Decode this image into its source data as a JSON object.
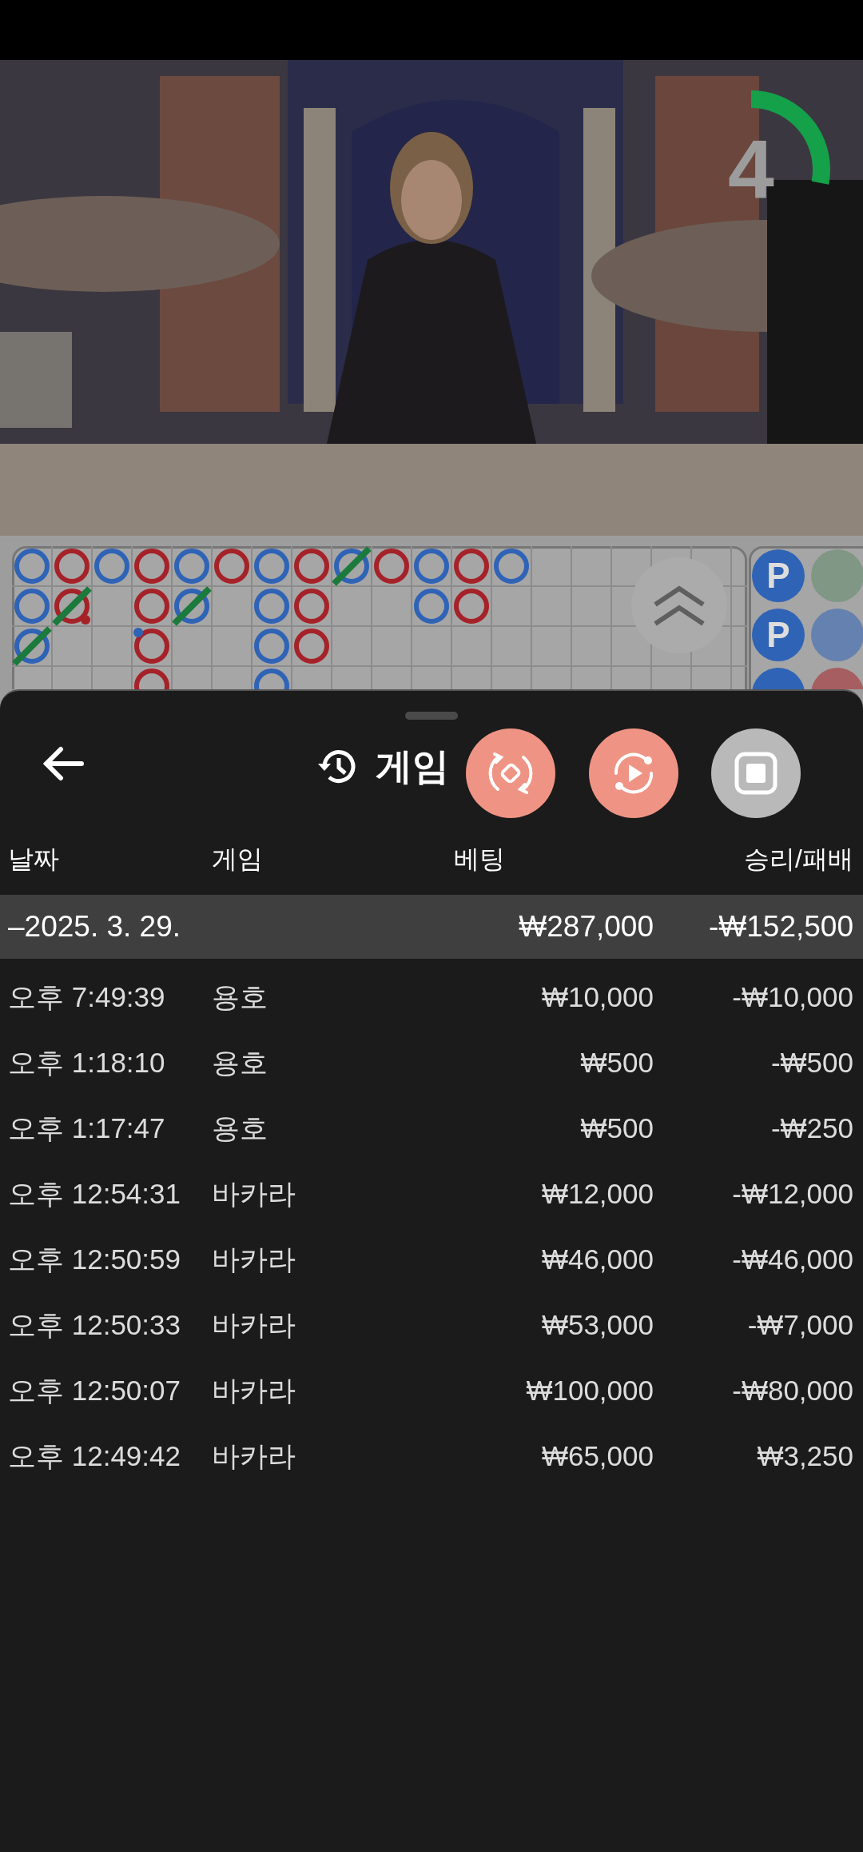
{
  "video": {
    "kind": "picture",
    "timer": {
      "value": "4",
      "level": 0.28
    }
  },
  "road": {
    "big_road": [
      [
        {
          "kind": "player",
          "tie": false,
          "banker_pair": false,
          "player_pair": false
        },
        {
          "kind": "player",
          "tie": false,
          "banker_pair": false,
          "player_pair": false
        },
        {
          "kind": "player",
          "tie": true,
          "banker_pair": false,
          "player_pair": false
        }
      ],
      [
        {
          "kind": "banker",
          "tie": false,
          "banker_pair": false,
          "player_pair": false
        },
        {
          "kind": "banker",
          "tie": true,
          "banker_pair": true,
          "player_pair": false
        }
      ],
      [
        {
          "kind": "player",
          "tie": false,
          "banker_pair": false,
          "player_pair": false
        }
      ],
      [
        {
          "kind": "banker",
          "tie": false,
          "banker_pair": false,
          "player_pair": false
        },
        {
          "kind": "banker",
          "tie": false,
          "banker_pair": false,
          "player_pair": false
        },
        {
          "kind": "banker",
          "tie": false,
          "banker_pair": false,
          "player_pair": true
        },
        {
          "kind": "banker",
          "tie": false,
          "banker_pair": false,
          "player_pair": false
        }
      ],
      [
        {
          "kind": "player",
          "tie": false,
          "banker_pair": false,
          "player_pair": false
        },
        {
          "kind": "player",
          "tie": true,
          "banker_pair": false,
          "player_pair": false
        }
      ],
      [
        {
          "kind": "banker",
          "tie": false,
          "banker_pair": false,
          "player_pair": false
        }
      ],
      [
        {
          "kind": "player",
          "tie": false,
          "banker_pair": false,
          "player_pair": false
        },
        {
          "kind": "player",
          "tie": false,
          "banker_pair": false,
          "player_pair": false
        },
        {
          "kind": "player",
          "tie": false,
          "banker_pair": false,
          "player_pair": false
        },
        {
          "kind": "player",
          "tie": false,
          "banker_pair": false,
          "player_pair": false
        }
      ],
      [
        {
          "kind": "banker",
          "tie": false,
          "banker_pair": false,
          "player_pair": false
        },
        {
          "kind": "banker",
          "tie": false,
          "banker_pair": false,
          "player_pair": false
        },
        {
          "kind": "banker",
          "tie": false,
          "banker_pair": false,
          "player_pair": false
        }
      ],
      [
        {
          "kind": "player",
          "tie": true,
          "banker_pair": false,
          "player_pair": false
        }
      ],
      [
        {
          "kind": "banker",
          "tie": false,
          "banker_pair": false,
          "player_pair": false
        }
      ],
      [
        {
          "kind": "player",
          "tie": false,
          "banker_pair": false,
          "player_pair": false
        },
        {
          "kind": "player",
          "tie": false,
          "banker_pair": false,
          "player_pair": false
        }
      ],
      [
        {
          "kind": "banker",
          "tie": false,
          "banker_pair": false,
          "player_pair": false
        },
        {
          "kind": "banker",
          "tie": false,
          "banker_pair": false,
          "player_pair": false
        }
      ],
      [
        {
          "kind": "player",
          "tie": false,
          "banker_pair": false,
          "player_pair": false
        }
      ]
    ],
    "bead_plate": [
      [
        {
          "kind": "player",
          "label": "P"
        },
        {
          "kind": "player",
          "label": "P"
        },
        {
          "kind": "player"
        }
      ],
      [
        {
          "kind": "tie"
        },
        {
          "kind": "player"
        },
        {
          "kind": "banker"
        }
      ]
    ]
  },
  "sheet": {
    "title": "게임",
    "actions": [
      {
        "kind": "swap",
        "active": true
      },
      {
        "kind": "replay",
        "active": true
      },
      {
        "kind": "stop",
        "active": false
      }
    ],
    "columns": [
      "날짜",
      "게임",
      "베팅",
      "승리/패배"
    ],
    "groups": [
      {
        "label": "–2025. 3. 29.",
        "bet": "₩287,000",
        "result": "-₩152,500",
        "rows": [
          {
            "time": "오후 7:49:39",
            "game": "용호",
            "bet": "₩10,000",
            "result": "-₩10,000"
          },
          {
            "time": "오후 1:18:10",
            "game": "용호",
            "bet": "₩500",
            "result": "-₩500"
          },
          {
            "time": "오후 1:17:47",
            "game": "용호",
            "bet": "₩500",
            "result": "-₩250"
          },
          {
            "time": "오후 12:54:31",
            "game": "바카라",
            "bet": "₩12,000",
            "result": "-₩12,000"
          },
          {
            "time": "오후 12:50:59",
            "game": "바카라",
            "bet": "₩46,000",
            "result": "-₩46,000"
          },
          {
            "time": "오후 12:50:33",
            "game": "바카라",
            "bet": "₩53,000",
            "result": "-₩7,000"
          },
          {
            "time": "오후 12:50:07",
            "game": "바카라",
            "bet": "₩100,000",
            "result": "-₩80,000"
          },
          {
            "time": "오후 12:49:42",
            "game": "바카라",
            "bet": "₩65,000",
            "result": "₩3,250"
          }
        ]
      }
    ]
  }
}
